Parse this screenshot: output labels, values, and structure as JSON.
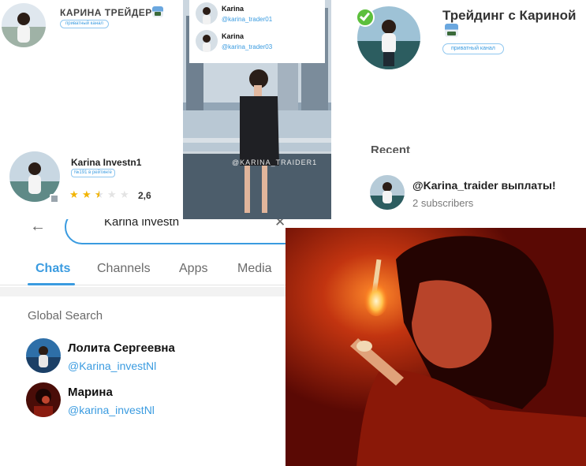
{
  "colors": {
    "link": "#3a9be0",
    "tab_active": "#3a9be0",
    "star": "#f2b400",
    "star_empty": "#e3e3e3",
    "check": "#5cbf3c"
  },
  "panel_a": {
    "title": "КАРИНА ТРЕЙДЕР",
    "badge": "приватный канал"
  },
  "panel_b": {
    "contacts": [
      {
        "name": "Karina",
        "handle": "@karina_trader01"
      },
      {
        "name": "Karina",
        "handle": "@karina_trader03"
      }
    ],
    "watermark": "@KARINA_TRAIDER1"
  },
  "panel_c": {
    "title_line1": "Трейдинг с Кариной",
    "badge": "приватный канал",
    "verified_icon": "check-badge-icon"
  },
  "panel_d": {
    "name": "Karina Investn1",
    "rank": "№191 в рейтинге",
    "rating": "2,6",
    "rating_value": 2.5,
    "rating_max": 5
  },
  "panel_e": {
    "section": "Recent",
    "title": "@Karina_traider выплаты!",
    "subtitle": "2 subscribers"
  },
  "search": {
    "query": "Karina investn",
    "tabs": [
      "Chats",
      "Channels",
      "Apps",
      "Media"
    ],
    "active_tab": "Chats",
    "section_title": "Global Search",
    "results": [
      {
        "name": "Лолита Сергеевна",
        "handle": "@Karina_investNl"
      },
      {
        "name": "Марина",
        "handle": "@karina_investNl"
      }
    ]
  }
}
